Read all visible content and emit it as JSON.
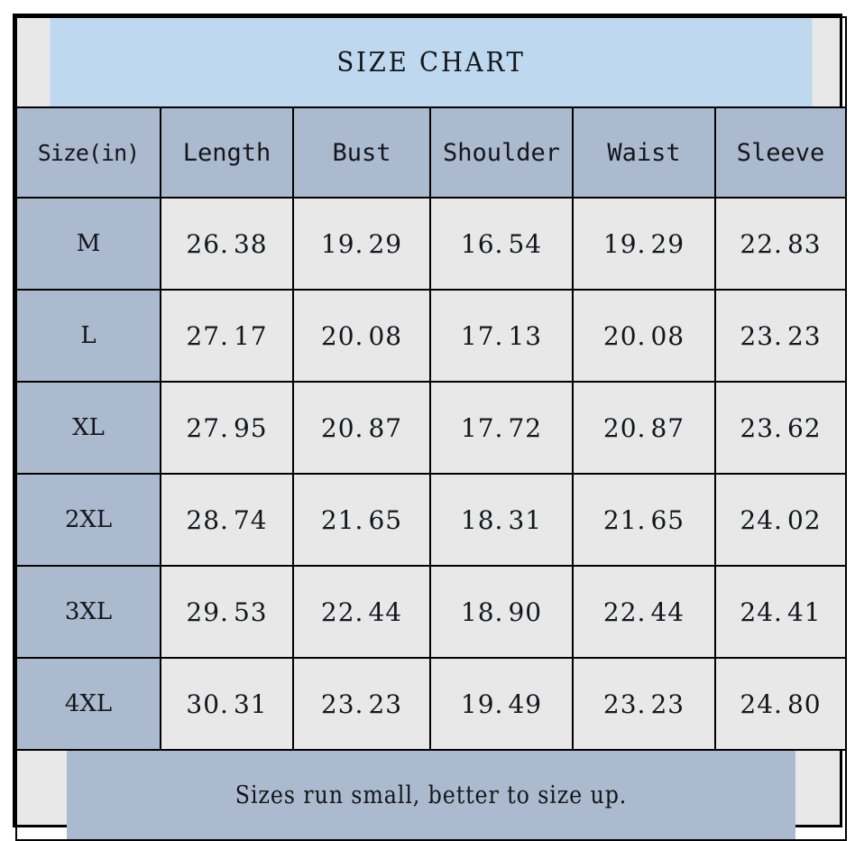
{
  "title": "SIZE CHART",
  "columns": [
    "Size(in)",
    "Length",
    "Bust",
    "Shoulder",
    "Waist",
    "Sleeve"
  ],
  "rows": [
    {
      "size": "M",
      "length": "26.38",
      "bust": "19.29",
      "shoulder": "16.54",
      "waist": "19.29",
      "sleeve": "22.83"
    },
    {
      "size": "L",
      "length": "27.17",
      "bust": "20.08",
      "shoulder": "17.13",
      "waist": "20.08",
      "sleeve": "23.23"
    },
    {
      "size": "XL",
      "length": "27.95",
      "bust": "20.87",
      "shoulder": "17.72",
      "waist": "20.87",
      "sleeve": "23.62"
    },
    {
      "size": "2XL",
      "length": "28.74",
      "bust": "21.65",
      "shoulder": "18.31",
      "waist": "21.65",
      "sleeve": "24.02"
    },
    {
      "size": "3XL",
      "length": "29.53",
      "bust": "22.44",
      "shoulder": "18.90",
      "waist": "22.44",
      "sleeve": "24.41"
    },
    {
      "size": "4XL",
      "length": "30.31",
      "bust": "23.23",
      "shoulder": "19.49",
      "waist": "23.23",
      "sleeve": "24.80"
    }
  ],
  "footer_note": "Sizes run small, better to size up.",
  "colors": {
    "title_background": "#bed8ef",
    "header_background": "#abbace",
    "size_column_background": "#abbace",
    "cell_background": "#e8e8e8",
    "border": "#000000",
    "text": "#13161c",
    "page_background": "#ffffff"
  },
  "chart_data": {
    "type": "table",
    "title": "SIZE CHART",
    "unit": "in",
    "categories": [
      "M",
      "L",
      "XL",
      "2XL",
      "3XL",
      "4XL"
    ],
    "columns": [
      "Size(in)",
      "Length",
      "Bust",
      "Shoulder",
      "Waist",
      "Sleeve"
    ],
    "series": [
      {
        "name": "Length",
        "values": [
          26.38,
          27.17,
          27.95,
          28.74,
          29.53,
          30.31
        ]
      },
      {
        "name": "Bust",
        "values": [
          19.29,
          20.08,
          20.87,
          21.65,
          22.44,
          23.23
        ]
      },
      {
        "name": "Shoulder",
        "values": [
          16.54,
          17.13,
          17.72,
          18.31,
          18.9,
          19.49
        ]
      },
      {
        "name": "Waist",
        "values": [
          19.29,
          20.08,
          20.87,
          21.65,
          22.44,
          23.23
        ]
      },
      {
        "name": "Sleeve",
        "values": [
          22.83,
          23.23,
          23.62,
          24.02,
          24.41,
          24.8
        ]
      }
    ],
    "annotations": [
      "Sizes run small, better to size up."
    ]
  }
}
